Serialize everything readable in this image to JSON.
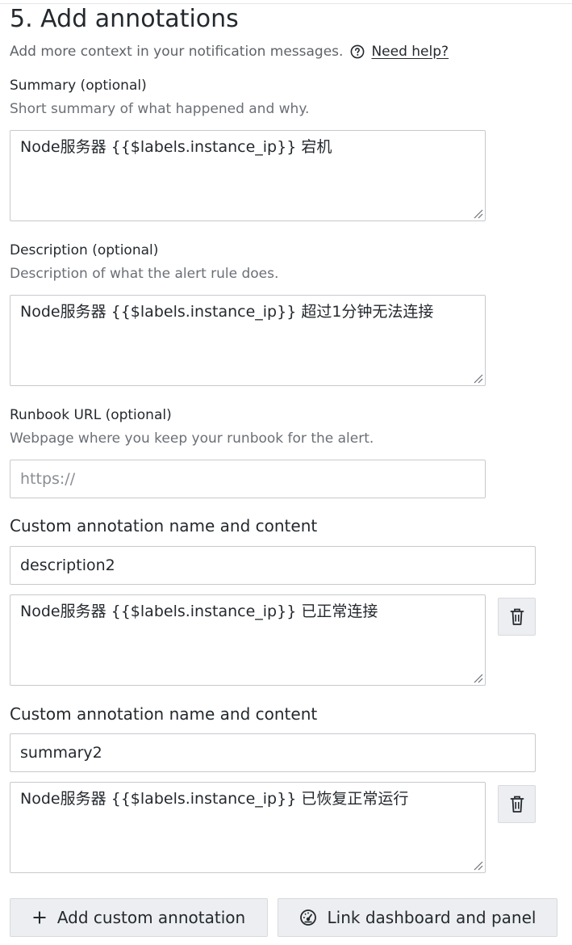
{
  "section": {
    "title": "5. Add annotations",
    "subtitle": "Add more context in your notification messages.",
    "help_link": "Need help?"
  },
  "summary": {
    "label": "Summary (optional)",
    "description": "Short summary of what happened and why.",
    "value": "Node服务器 {{$labels.instance_ip}} 宕机"
  },
  "description": {
    "label": "Description (optional)",
    "description": "Description of what the alert rule does.",
    "value": "Node服务器 {{$labels.instance_ip}} 超过1分钟无法连接"
  },
  "runbook": {
    "label": "Runbook URL (optional)",
    "description": "Webpage where you keep your runbook for the alert.",
    "placeholder": "https://",
    "value": ""
  },
  "custom_annotations": [
    {
      "title": "Custom annotation name and content",
      "name": "description2",
      "content": "Node服务器 {{$labels.instance_ip}} 已正常连接"
    },
    {
      "title": "Custom annotation name and content",
      "name": "summary2",
      "content": "Node服务器 {{$labels.instance_ip}} 已恢复正常运行"
    }
  ],
  "actions": {
    "add_custom_label": "Add custom annotation",
    "link_dashboard_label": "Link dashboard and panel"
  },
  "icons": {
    "help": "question-circle-icon",
    "delete": "trash-icon",
    "add": "plus-icon",
    "dashboard": "dashboard-gauge-icon"
  }
}
